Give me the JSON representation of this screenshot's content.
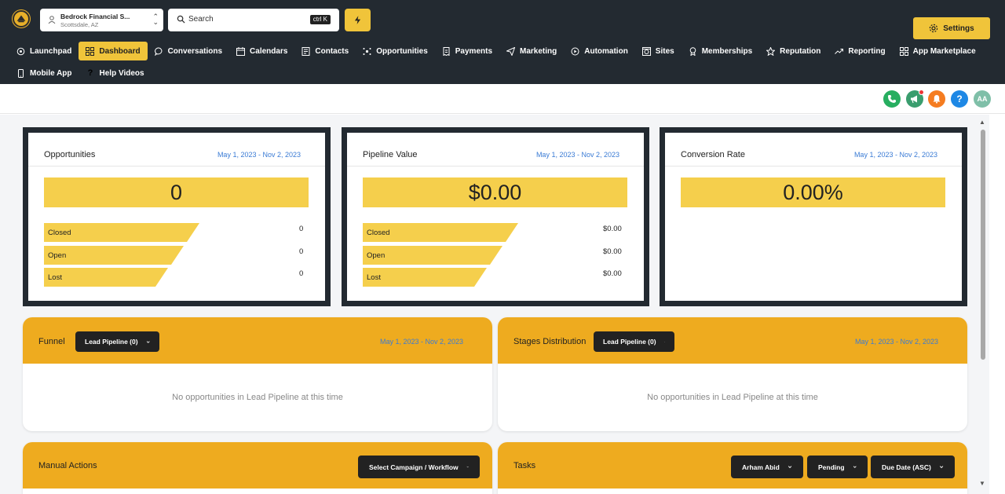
{
  "header": {
    "account_name": "Bedrock Financial S...",
    "account_location": "Scottsdale, AZ",
    "search_placeholder": "Search",
    "search_shortcut": "ctrl K",
    "settings_label": "Settings"
  },
  "nav": {
    "row1": [
      {
        "label": "Launchpad",
        "icon": "rocket-icon",
        "active": false
      },
      {
        "label": "Dashboard",
        "icon": "grid-icon",
        "active": true
      },
      {
        "label": "Conversations",
        "icon": "chat-icon",
        "active": false
      },
      {
        "label": "Calendars",
        "icon": "calendar-icon",
        "active": false
      },
      {
        "label": "Contacts",
        "icon": "contacts-icon",
        "active": false
      },
      {
        "label": "Opportunities",
        "icon": "opportunities-icon",
        "active": false
      },
      {
        "label": "Payments",
        "icon": "receipt-icon",
        "active": false
      },
      {
        "label": "Marketing",
        "icon": "send-icon",
        "active": false
      },
      {
        "label": "Automation",
        "icon": "automation-icon",
        "active": false
      },
      {
        "label": "Sites",
        "icon": "globe-icon",
        "active": false
      },
      {
        "label": "Memberships",
        "icon": "award-icon",
        "active": false
      },
      {
        "label": "Reputation",
        "icon": "star-icon",
        "active": false
      },
      {
        "label": "Reporting",
        "icon": "trend-icon",
        "active": false
      },
      {
        "label": "App Marketplace",
        "icon": "apps-icon",
        "active": false
      }
    ],
    "row2": [
      {
        "label": "Mobile App",
        "icon": "mobile-icon"
      },
      {
        "label": "Help Videos",
        "icon": "question-icon"
      }
    ]
  },
  "subbar": {
    "avatar_initials": "AA",
    "colors": {
      "phone": "#27ae60",
      "megaphone": "#3a9d6e",
      "bell": "#f57c20",
      "help": "#1e88e5",
      "avatar": "#7fbfa8"
    }
  },
  "cards": [
    {
      "title": "Opportunities",
      "date_range": "May 1, 2023 - Nov 2, 2023",
      "value": "0",
      "rows": [
        {
          "label": "Closed",
          "value": "0"
        },
        {
          "label": "Open",
          "value": "0"
        },
        {
          "label": "Lost",
          "value": "0"
        }
      ]
    },
    {
      "title": "Pipeline Value",
      "date_range": "May 1, 2023 - Nov 2, 2023",
      "value": "$0.00",
      "rows": [
        {
          "label": "Closed",
          "value": "$0.00"
        },
        {
          "label": "Open",
          "value": "$0.00"
        },
        {
          "label": "Lost",
          "value": "$0.00"
        }
      ]
    },
    {
      "title": "Conversion Rate",
      "date_range": "May 1, 2023 - Nov 2, 2023",
      "value": "0.00%",
      "rows": []
    }
  ],
  "panels": {
    "funnel": {
      "title": "Funnel",
      "pipeline": "Lead Pipeline (0)",
      "date_range": "May 1, 2023 - Nov 2, 2023",
      "empty": "No opportunities in Lead Pipeline at this time"
    },
    "stages": {
      "title": "Stages Distribution",
      "pipeline": "Lead Pipeline (0)",
      "date_range": "May 1, 2023 - Nov 2, 2023",
      "empty": "No opportunities in Lead Pipeline at this time"
    },
    "manual_actions": {
      "title": "Manual Actions",
      "select_label": "Select Campaign / Workflow"
    },
    "tasks": {
      "title": "Tasks",
      "assignee": "Arham Abid",
      "status": "Pending",
      "sort": "Due Date (ASC)"
    }
  }
}
